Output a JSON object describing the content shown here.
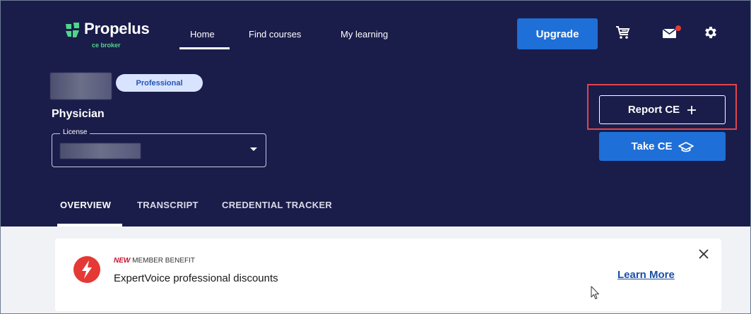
{
  "header": {
    "logo": {
      "name": "Propelus",
      "sub": "ce broker"
    },
    "nav": [
      {
        "label": "Home",
        "active": true
      },
      {
        "label": "Find courses",
        "active": false
      },
      {
        "label": "My learning",
        "active": false
      }
    ],
    "upgrade_label": "Upgrade",
    "icons": [
      "cart-icon",
      "mail-icon",
      "gear-icon"
    ],
    "mail_has_notification": true
  },
  "profile": {
    "badge": "Professional",
    "profession": "Physician",
    "license_label": "License"
  },
  "actions": {
    "report_ce": "Report CE",
    "take_ce": "Take CE"
  },
  "tabs": [
    {
      "label": "OVERVIEW",
      "active": true
    },
    {
      "label": "TRANSCRIPT",
      "active": false
    },
    {
      "label": "CREDENTIAL TRACKER",
      "active": false
    }
  ],
  "benefit": {
    "kicker_new": "NEW",
    "kicker_rest": " MEMBER BENEFIT",
    "title": "ExpertVoice professional discounts",
    "link": "Learn More"
  },
  "colors": {
    "header_bg": "#1a1d4a",
    "primary_button": "#1f6fd8",
    "brand_green": "#4fd68a",
    "badge_bg": "#d8e4ff",
    "highlight": "#e2444c",
    "alert_red": "#e53935"
  }
}
